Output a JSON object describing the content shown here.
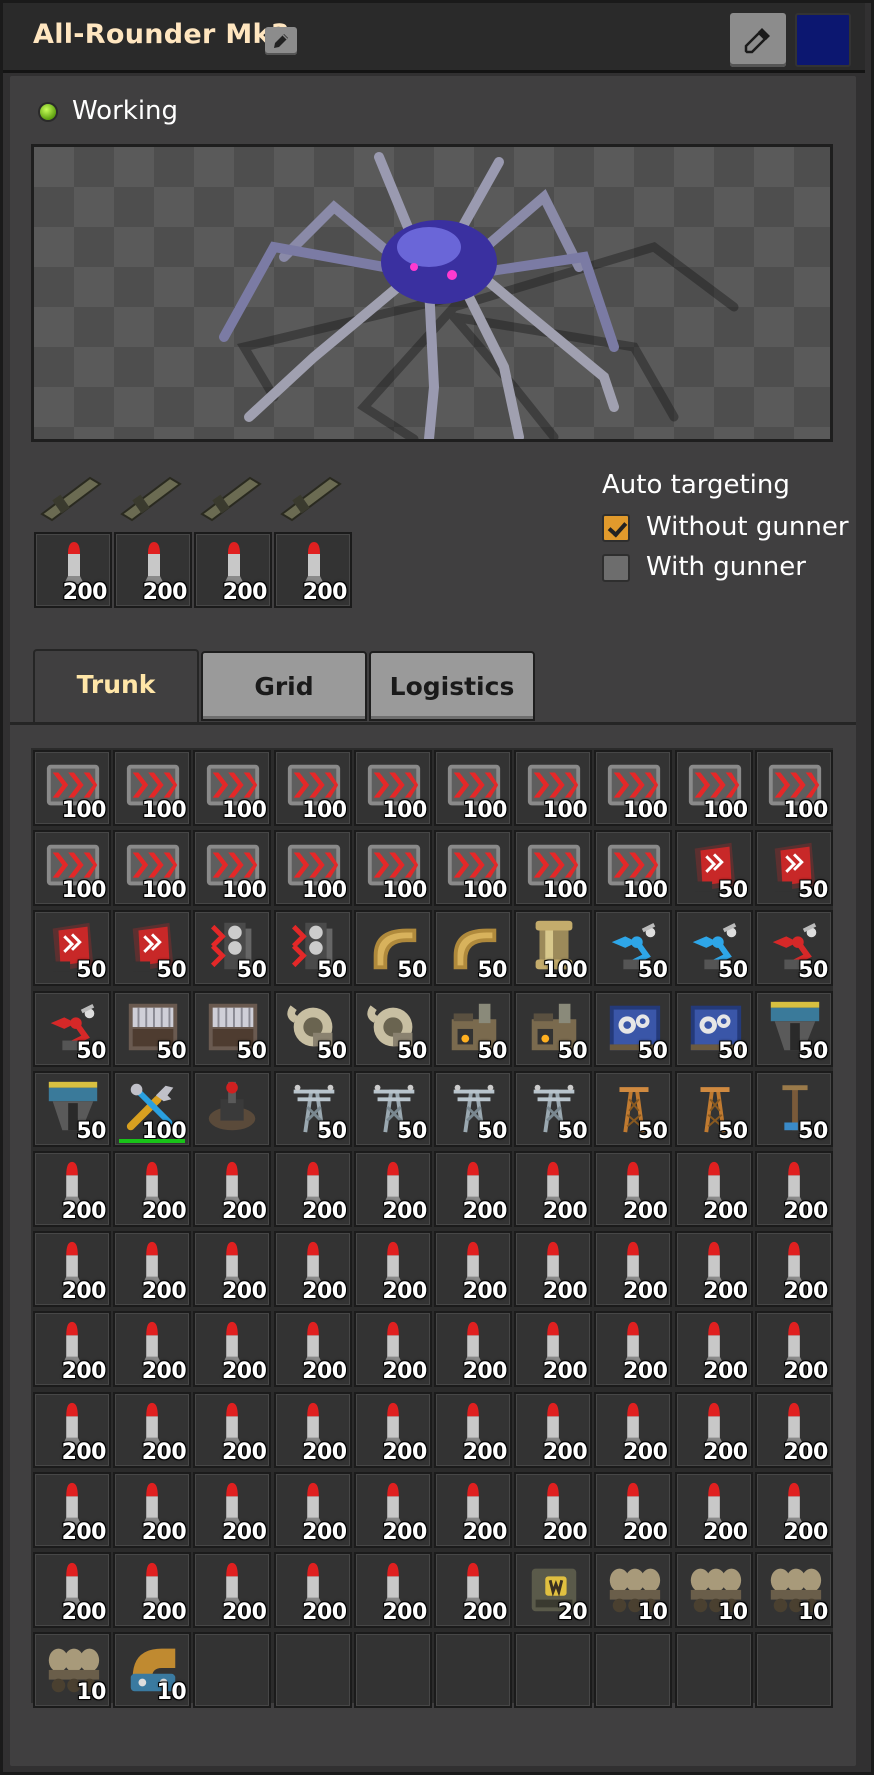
{
  "window": {
    "title": "All-Rounder Mk3",
    "color": "#0c1770"
  },
  "status": {
    "text": "Working",
    "color": "#7ec81e"
  },
  "weapons": {
    "ammo_counts": [
      "200",
      "200",
      "200",
      "200"
    ]
  },
  "auto_targeting": {
    "title": "Auto targeting",
    "without_gunner": {
      "label": "Without gunner",
      "checked": true
    },
    "with_gunner": {
      "label": "With gunner",
      "checked": false
    }
  },
  "tabs": [
    {
      "label": "Trunk",
      "active": true
    },
    {
      "label": "Grid",
      "active": false
    },
    {
      "label": "Logistics",
      "active": false
    }
  ],
  "inventory": [
    {
      "icon": "express-transport-belt-icon",
      "count": "100"
    },
    {
      "icon": "express-transport-belt-icon",
      "count": "100"
    },
    {
      "icon": "express-transport-belt-icon",
      "count": "100"
    },
    {
      "icon": "express-transport-belt-icon",
      "count": "100"
    },
    {
      "icon": "express-transport-belt-icon",
      "count": "100"
    },
    {
      "icon": "express-transport-belt-icon",
      "count": "100"
    },
    {
      "icon": "express-transport-belt-icon",
      "count": "100"
    },
    {
      "icon": "express-transport-belt-icon",
      "count": "100"
    },
    {
      "icon": "express-transport-belt-icon",
      "count": "100"
    },
    {
      "icon": "express-transport-belt-icon",
      "count": "100"
    },
    {
      "icon": "express-transport-belt-icon",
      "count": "100"
    },
    {
      "icon": "express-transport-belt-icon",
      "count": "100"
    },
    {
      "icon": "express-transport-belt-icon",
      "count": "100"
    },
    {
      "icon": "express-transport-belt-icon",
      "count": "100"
    },
    {
      "icon": "express-transport-belt-icon",
      "count": "100"
    },
    {
      "icon": "express-transport-belt-icon",
      "count": "100"
    },
    {
      "icon": "express-transport-belt-icon",
      "count": "100"
    },
    {
      "icon": "express-transport-belt-icon",
      "count": "100"
    },
    {
      "icon": "express-underground-belt-icon",
      "count": "50"
    },
    {
      "icon": "express-underground-belt-icon",
      "count": "50"
    },
    {
      "icon": "express-underground-belt-icon",
      "count": "50"
    },
    {
      "icon": "express-underground-belt-icon",
      "count": "50"
    },
    {
      "icon": "express-splitter-icon",
      "count": "50"
    },
    {
      "icon": "express-splitter-icon",
      "count": "50"
    },
    {
      "icon": "pipe-to-ground-icon",
      "count": "50"
    },
    {
      "icon": "pipe-to-ground-icon",
      "count": "50"
    },
    {
      "icon": "pipe-icon",
      "count": "100"
    },
    {
      "icon": "stack-inserter-icon",
      "count": "50"
    },
    {
      "icon": "stack-inserter-icon",
      "count": "50"
    },
    {
      "icon": "fast-inserter-icon",
      "count": "50"
    },
    {
      "icon": "fast-inserter-icon",
      "count": "50"
    },
    {
      "icon": "steel-chest-icon",
      "count": "50"
    },
    {
      "icon": "steel-chest-icon",
      "count": "50"
    },
    {
      "icon": "pump-icon",
      "count": "50"
    },
    {
      "icon": "pump-icon",
      "count": "50"
    },
    {
      "icon": "steel-furnace-icon",
      "count": "50"
    },
    {
      "icon": "steel-furnace-icon",
      "count": "50"
    },
    {
      "icon": "assembling-machine-icon",
      "count": "50"
    },
    {
      "icon": "assembling-machine-icon",
      "count": "50"
    },
    {
      "icon": "electric-mining-drill-icon",
      "count": "50"
    },
    {
      "icon": "electric-mining-drill-icon",
      "count": "50"
    },
    {
      "icon": "repair-pack-icon",
      "count": "100",
      "durability": true
    },
    {
      "icon": "radar-icon",
      "count": ""
    },
    {
      "icon": "big-electric-pole-icon",
      "count": "50"
    },
    {
      "icon": "big-electric-pole-icon",
      "count": "50"
    },
    {
      "icon": "big-electric-pole-icon",
      "count": "50"
    },
    {
      "icon": "big-electric-pole-icon",
      "count": "50"
    },
    {
      "icon": "medium-electric-pole-icon",
      "count": "50"
    },
    {
      "icon": "medium-electric-pole-icon",
      "count": "50"
    },
    {
      "icon": "small-electric-pole-icon",
      "count": "50"
    },
    {
      "icon": "rocket-icon",
      "count": "200"
    },
    {
      "icon": "rocket-icon",
      "count": "200"
    },
    {
      "icon": "rocket-icon",
      "count": "200"
    },
    {
      "icon": "rocket-icon",
      "count": "200"
    },
    {
      "icon": "rocket-icon",
      "count": "200"
    },
    {
      "icon": "rocket-icon",
      "count": "200"
    },
    {
      "icon": "rocket-icon",
      "count": "200"
    },
    {
      "icon": "rocket-icon",
      "count": "200"
    },
    {
      "icon": "rocket-icon",
      "count": "200"
    },
    {
      "icon": "rocket-icon",
      "count": "200"
    },
    {
      "icon": "rocket-icon",
      "count": "200"
    },
    {
      "icon": "rocket-icon",
      "count": "200"
    },
    {
      "icon": "rocket-icon",
      "count": "200"
    },
    {
      "icon": "rocket-icon",
      "count": "200"
    },
    {
      "icon": "rocket-icon",
      "count": "200"
    },
    {
      "icon": "rocket-icon",
      "count": "200"
    },
    {
      "icon": "rocket-icon",
      "count": "200"
    },
    {
      "icon": "rocket-icon",
      "count": "200"
    },
    {
      "icon": "rocket-icon",
      "count": "200"
    },
    {
      "icon": "rocket-icon",
      "count": "200"
    },
    {
      "icon": "rocket-icon",
      "count": "200"
    },
    {
      "icon": "rocket-icon",
      "count": "200"
    },
    {
      "icon": "rocket-icon",
      "count": "200"
    },
    {
      "icon": "rocket-icon",
      "count": "200"
    },
    {
      "icon": "rocket-icon",
      "count": "200"
    },
    {
      "icon": "rocket-icon",
      "count": "200"
    },
    {
      "icon": "rocket-icon",
      "count": "200"
    },
    {
      "icon": "rocket-icon",
      "count": "200"
    },
    {
      "icon": "rocket-icon",
      "count": "200"
    },
    {
      "icon": "rocket-icon",
      "count": "200"
    },
    {
      "icon": "rocket-icon",
      "count": "200"
    },
    {
      "icon": "rocket-icon",
      "count": "200"
    },
    {
      "icon": "rocket-icon",
      "count": "200"
    },
    {
      "icon": "rocket-icon",
      "count": "200"
    },
    {
      "icon": "rocket-icon",
      "count": "200"
    },
    {
      "icon": "rocket-icon",
      "count": "200"
    },
    {
      "icon": "rocket-icon",
      "count": "200"
    },
    {
      "icon": "rocket-icon",
      "count": "200"
    },
    {
      "icon": "rocket-icon",
      "count": "200"
    },
    {
      "icon": "rocket-icon",
      "count": "200"
    },
    {
      "icon": "rocket-icon",
      "count": "200"
    },
    {
      "icon": "rocket-icon",
      "count": "200"
    },
    {
      "icon": "rocket-icon",
      "count": "200"
    },
    {
      "icon": "rocket-icon",
      "count": "200"
    },
    {
      "icon": "rocket-icon",
      "count": "200"
    },
    {
      "icon": "rocket-icon",
      "count": "200"
    },
    {
      "icon": "rocket-icon",
      "count": "200"
    },
    {
      "icon": "rocket-icon",
      "count": "200"
    },
    {
      "icon": "rocket-icon",
      "count": "200"
    },
    {
      "icon": "rocket-icon",
      "count": "200"
    },
    {
      "icon": "rocket-icon",
      "count": "200"
    },
    {
      "icon": "rocket-icon",
      "count": "200"
    },
    {
      "icon": "rocket-icon",
      "count": "200"
    },
    {
      "icon": "rocket-icon",
      "count": "200"
    },
    {
      "icon": "rocket-icon",
      "count": "200"
    },
    {
      "icon": "rocket-icon",
      "count": "200"
    },
    {
      "icon": "fusion-reactor-equipment-icon",
      "count": "20"
    },
    {
      "icon": "exoskeleton-equipment-icon",
      "count": "10"
    },
    {
      "icon": "exoskeleton-equipment-icon",
      "count": "10"
    },
    {
      "icon": "exoskeleton-equipment-icon",
      "count": "10"
    },
    {
      "icon": "exoskeleton-equipment-icon",
      "count": "10"
    },
    {
      "icon": "personal-roboport-equipment-icon",
      "count": "10"
    },
    {
      "icon": "empty-slot",
      "count": ""
    },
    {
      "icon": "empty-slot",
      "count": ""
    },
    {
      "icon": "empty-slot",
      "count": ""
    },
    {
      "icon": "empty-slot",
      "count": ""
    },
    {
      "icon": "empty-slot",
      "count": ""
    },
    {
      "icon": "empty-slot",
      "count": ""
    },
    {
      "icon": "empty-slot",
      "count": ""
    },
    {
      "icon": "empty-slot",
      "count": ""
    }
  ]
}
